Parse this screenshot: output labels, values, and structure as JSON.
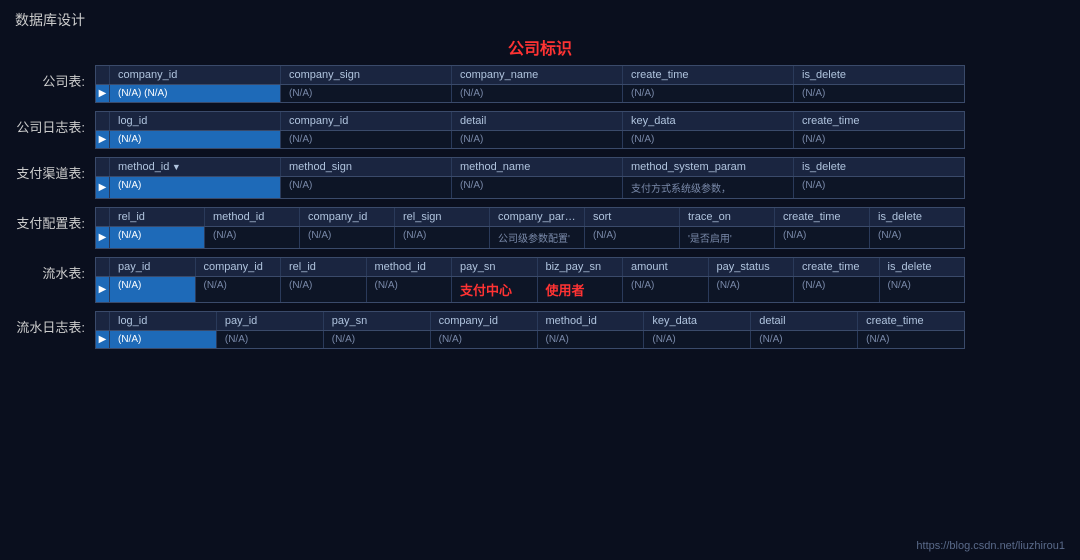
{
  "pageTitle": "数据库设计",
  "companyLabel": "公司标识",
  "footerUrl": "https://blog.csdn.net/liuzhirou1",
  "tables": [
    {
      "label": "公司表:",
      "columns": [
        "company_id",
        "company_sign",
        "company_name",
        "create_time",
        "is_delete"
      ],
      "rows": [
        [
          "(N/A) (N/A)",
          "(N/A)",
          "(N/A)",
          "(N/A)",
          "(N/A)"
        ]
      ],
      "selectedCol": 0,
      "arrowCol": -1
    },
    {
      "label": "公司日志表:",
      "columns": [
        "log_id",
        "company_id",
        "detail",
        "key_data",
        "create_time"
      ],
      "rows": [
        [
          "(N/A)",
          "(N/A)",
          "(N/A)",
          "(N/A)",
          "(N/A)"
        ]
      ],
      "selectedCol": 0,
      "arrowCol": -1
    },
    {
      "label": "支付渠道表:",
      "columns": [
        "method_id",
        "method_sign",
        "method_name",
        "method_system_param",
        "is_delete"
      ],
      "rows": [
        [
          "(N/A)",
          "(N/A)",
          "(N/A)",
          "支付方式系统级参数，",
          "(N/A)"
        ]
      ],
      "selectedCol": 0,
      "arrowCol": 0
    },
    {
      "label": "支付配置表:",
      "columns": [
        "rel_id",
        "method_id",
        "company_id",
        "rel_sign",
        "company_param",
        "sort",
        "trace_on",
        "create_time",
        "is_delete"
      ],
      "rows": [
        [
          "(N/A)",
          "(N/A)",
          "(N/A)",
          "(N/A)",
          "公司级参数配置'",
          "(N/A)",
          "'是否启用'",
          "(N/A)",
          "(N/A)"
        ]
      ],
      "selectedCol": 0,
      "arrowCol": -1
    },
    {
      "label": "流水表:",
      "columns": [
        "pay_id",
        "company_id",
        "rel_id",
        "method_id",
        "pay_sn",
        "biz_pay_sn",
        "amount",
        "pay_status",
        "create_time",
        "is_delete"
      ],
      "rows": [
        [
          "(N/A)",
          "(N/A)",
          "(N/A)",
          "(N/A)",
          "支付中心",
          "使用者",
          "(N/A)",
          "(N/A)",
          "(N/A)",
          "(N/A)"
        ]
      ],
      "selectedCol": 0,
      "arrowCol": -1,
      "redCols": [
        4,
        5
      ]
    },
    {
      "label": "流水日志表:",
      "columns": [
        "log_id",
        "pay_id",
        "pay_sn",
        "company_id",
        "method_id",
        "key_data",
        "detail",
        "create_time"
      ],
      "rows": [
        [
          "(N/A)",
          "(N/A)",
          "(N/A)",
          "(N/A)",
          "(N/A)",
          "(N/A)",
          "(N/A)",
          "(N/A)"
        ]
      ],
      "selectedCol": 0,
      "arrowCol": -1
    }
  ]
}
